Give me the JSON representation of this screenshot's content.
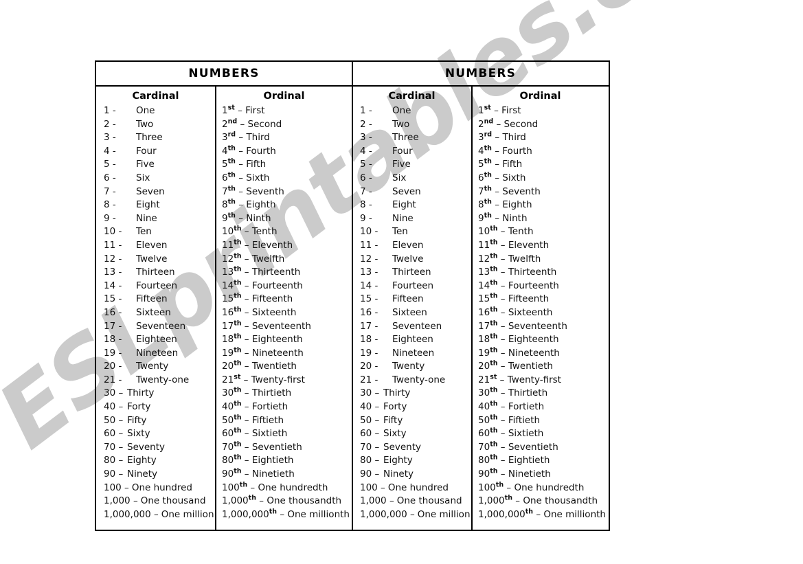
{
  "watermark": {
    "text": "ESLprintables.com"
  },
  "tables": [
    {
      "id": "left",
      "title": "NUMBERS",
      "columns": {
        "cardinal": "Cardinal",
        "ordinal": "Ordinal"
      },
      "cardinal_rows": [
        {
          "num": "1 -",
          "word": "One",
          "spaced": true
        },
        {
          "num": "2 -",
          "word": "Two",
          "spaced": true
        },
        {
          "num": "3 -",
          "word": "Three",
          "spaced": true
        },
        {
          "num": "4 -",
          "word": "Four",
          "spaced": true
        },
        {
          "num": "5 -",
          "word": "Five",
          "spaced": true
        },
        {
          "num": "6 -",
          "word": "Six",
          "spaced": true
        },
        {
          "num": "7 -",
          "word": "Seven",
          "spaced": true
        },
        {
          "num": "8 -",
          "word": "Eight",
          "spaced": true
        },
        {
          "num": "9 -",
          "word": "Nine",
          "spaced": true
        },
        {
          "num": "10 -",
          "word": "Ten",
          "spaced": true
        },
        {
          "num": "11 -",
          "word": "Eleven",
          "spaced": true
        },
        {
          "num": "12 -",
          "word": "Twelve",
          "spaced": true
        },
        {
          "num": "13 -",
          "word": "Thirteen",
          "spaced": true
        },
        {
          "num": "14 -",
          "word": "Fourteen",
          "spaced": true
        },
        {
          "num": "15 -",
          "word": "Fifteen",
          "spaced": true
        },
        {
          "num": "16 -",
          "word": "Sixteen",
          "spaced": true
        },
        {
          "num": "17 -",
          "word": "Seventeen",
          "spaced": true
        },
        {
          "num": "18 -",
          "word": "Eighteen",
          "spaced": true
        },
        {
          "num": "19 -",
          "word": "Nineteen",
          "spaced": true
        },
        {
          "num": "20 -",
          "word": "Twenty",
          "spaced": true
        },
        {
          "num": "21 -",
          "word": "Twenty-one",
          "spaced": true
        },
        {
          "num": "30 –",
          "word": "Thirty",
          "spaced": false
        },
        {
          "num": "40 –",
          "word": "Forty",
          "spaced": false
        },
        {
          "num": "50 –",
          "word": "Fifty",
          "spaced": false
        },
        {
          "num": "60 –",
          "word": "Sixty",
          "spaced": false
        },
        {
          "num": "70 –",
          "word": "Seventy",
          "spaced": false
        },
        {
          "num": "80 –",
          "word": "Eighty",
          "spaced": false
        },
        {
          "num": "90 –",
          "word": "Ninety",
          "spaced": false
        },
        {
          "num": "100 –",
          "word": "One hundred",
          "spaced": false
        },
        {
          "num": "1,000 –",
          "word": "One thousand",
          "spaced": false
        },
        {
          "num": "1,000,000 –",
          "word": "One million",
          "spaced": false
        }
      ],
      "ordinal_rows": [
        {
          "num": "1",
          "sup": "st",
          "word": "First"
        },
        {
          "num": "2",
          "sup": "nd",
          "word": "Second"
        },
        {
          "num": "3",
          "sup": "rd",
          "word": "Third"
        },
        {
          "num": "4",
          "sup": "th",
          "word": "Fourth"
        },
        {
          "num": "5",
          "sup": "th",
          "word": "Fifth"
        },
        {
          "num": "6",
          "sup": "th",
          "word": "Sixth"
        },
        {
          "num": "7",
          "sup": "th",
          "word": "Seventh"
        },
        {
          "num": "8",
          "sup": "th",
          "word": "Eighth"
        },
        {
          "num": "9",
          "sup": "th",
          "word": "Ninth"
        },
        {
          "num": "10",
          "sup": "th",
          "word": "Tenth"
        },
        {
          "num": "11",
          "sup": "th",
          "word": "Eleventh"
        },
        {
          "num": "12",
          "sup": "th",
          "word": "Twelfth"
        },
        {
          "num": "13",
          "sup": "th",
          "word": "Thirteenth"
        },
        {
          "num": "14",
          "sup": "th",
          "word": "Fourteenth"
        },
        {
          "num": "15",
          "sup": "th",
          "word": "Fifteenth"
        },
        {
          "num": "16",
          "sup": "th",
          "word": "Sixteenth"
        },
        {
          "num": "17",
          "sup": "th",
          "word": "Seventeenth"
        },
        {
          "num": "18",
          "sup": "th",
          "word": "Eighteenth"
        },
        {
          "num": "19",
          "sup": "th",
          "word": "Nineteenth"
        },
        {
          "num": "20",
          "sup": "th",
          "word": "Twentieth"
        },
        {
          "num": "21",
          "sup": "st",
          "word": "Twenty-first"
        },
        {
          "num": "30",
          "sup": "th",
          "word": "Thirtieth"
        },
        {
          "num": "40",
          "sup": "th",
          "word": "Fortieth"
        },
        {
          "num": "50",
          "sup": "th",
          "word": "Fiftieth"
        },
        {
          "num": "60",
          "sup": "th",
          "word": "Sixtieth"
        },
        {
          "num": "70",
          "sup": "th",
          "word": "Seventieth"
        },
        {
          "num": "80",
          "sup": "th",
          "word": "Eightieth"
        },
        {
          "num": "90",
          "sup": "th",
          "word": "Ninetieth"
        },
        {
          "num": "100",
          "sup": "th",
          "word": "One hundredth"
        },
        {
          "num": "1,000",
          "sup": "th",
          "word": "One thousandth"
        },
        {
          "num": "1,000,000",
          "sup": "th",
          "word": "One millionth"
        }
      ]
    },
    {
      "id": "right",
      "title": "NUMBERS",
      "columns": {
        "cardinal": "Cardinal",
        "ordinal": "Ordinal"
      },
      "cardinal_rows": [
        {
          "num": "1 -",
          "word": "One",
          "spaced": true
        },
        {
          "num": "2 -",
          "word": "Two",
          "spaced": true
        },
        {
          "num": "3 -",
          "word": "Three",
          "spaced": true
        },
        {
          "num": "4 -",
          "word": "Four",
          "spaced": true
        },
        {
          "num": "5 -",
          "word": "Five",
          "spaced": true
        },
        {
          "num": "6 -",
          "word": "Six",
          "spaced": true
        },
        {
          "num": "7 -",
          "word": "Seven",
          "spaced": true
        },
        {
          "num": "8 -",
          "word": "Eight",
          "spaced": true
        },
        {
          "num": "9 -",
          "word": "Nine",
          "spaced": true
        },
        {
          "num": "10 -",
          "word": "Ten",
          "spaced": true
        },
        {
          "num": "11 -",
          "word": "Eleven",
          "spaced": true
        },
        {
          "num": "12 -",
          "word": "Twelve",
          "spaced": true
        },
        {
          "num": "13 -",
          "word": "Thirteen",
          "spaced": true
        },
        {
          "num": "14 -",
          "word": "Fourteen",
          "spaced": true
        },
        {
          "num": "15 -",
          "word": "Fifteen",
          "spaced": true
        },
        {
          "num": "16 -",
          "word": "Sixteen",
          "spaced": true
        },
        {
          "num": "17 -",
          "word": "Seventeen",
          "spaced": true
        },
        {
          "num": "18 -",
          "word": "Eighteen",
          "spaced": true
        },
        {
          "num": "19 -",
          "word": "Nineteen",
          "spaced": true
        },
        {
          "num": "20 -",
          "word": "Twenty",
          "spaced": true
        },
        {
          "num": "21 -",
          "word": "Twenty-one",
          "spaced": true
        },
        {
          "num": "30 –",
          "word": "Thirty",
          "spaced": false
        },
        {
          "num": "40 –",
          "word": "Forty",
          "spaced": false
        },
        {
          "num": "50 –",
          "word": "Fifty",
          "spaced": false
        },
        {
          "num": "60 –",
          "word": "Sixty",
          "spaced": false
        },
        {
          "num": "70 –",
          "word": "Seventy",
          "spaced": false
        },
        {
          "num": "80 –",
          "word": "Eighty",
          "spaced": false
        },
        {
          "num": "90 –",
          "word": "Ninety",
          "spaced": false
        },
        {
          "num": "100 –",
          "word": "One hundred",
          "spaced": false
        },
        {
          "num": "1,000 –",
          "word": "One thousand",
          "spaced": false
        },
        {
          "num": "1,000,000 –",
          "word": "One million",
          "spaced": false
        }
      ],
      "ordinal_rows": [
        {
          "num": "1",
          "sup": "st",
          "word": "First"
        },
        {
          "num": "2",
          "sup": "nd",
          "word": "Second"
        },
        {
          "num": "3",
          "sup": "rd",
          "word": "Third"
        },
        {
          "num": "4",
          "sup": "th",
          "word": "Fourth"
        },
        {
          "num": "5",
          "sup": "th",
          "word": "Fifth"
        },
        {
          "num": "6",
          "sup": "th",
          "word": "Sixth"
        },
        {
          "num": "7",
          "sup": "th",
          "word": "Seventh"
        },
        {
          "num": "8",
          "sup": "th",
          "word": "Eighth"
        },
        {
          "num": "9",
          "sup": "th",
          "word": "Ninth"
        },
        {
          "num": "10",
          "sup": "th",
          "word": "Tenth"
        },
        {
          "num": "11",
          "sup": "th",
          "word": "Eleventh"
        },
        {
          "num": "12",
          "sup": "th",
          "word": "Twelfth"
        },
        {
          "num": "13",
          "sup": "th",
          "word": "Thirteenth"
        },
        {
          "num": "14",
          "sup": "th",
          "word": "Fourteenth"
        },
        {
          "num": "15",
          "sup": "th",
          "word": "Fifteenth"
        },
        {
          "num": "16",
          "sup": "th",
          "word": "Sixteenth"
        },
        {
          "num": "17",
          "sup": "th",
          "word": "Seventeenth"
        },
        {
          "num": "18",
          "sup": "th",
          "word": "Eighteenth"
        },
        {
          "num": "19",
          "sup": "th",
          "word": "Nineteenth"
        },
        {
          "num": "20",
          "sup": "th",
          "word": "Twentieth"
        },
        {
          "num": "21",
          "sup": "st",
          "word": "Twenty-first"
        },
        {
          "num": "30",
          "sup": "th",
          "word": "Thirtieth"
        },
        {
          "num": "40",
          "sup": "th",
          "word": "Fortieth"
        },
        {
          "num": "50",
          "sup": "th",
          "word": "Fiftieth"
        },
        {
          "num": "60",
          "sup": "th",
          "word": "Sixtieth"
        },
        {
          "num": "70",
          "sup": "th",
          "word": "Seventieth"
        },
        {
          "num": "80",
          "sup": "th",
          "word": "Eightieth"
        },
        {
          "num": "90",
          "sup": "th",
          "word": "Ninetieth"
        },
        {
          "num": "100",
          "sup": "th",
          "word": "One hundredth"
        },
        {
          "num": "1,000",
          "sup": "th",
          "word": "One thousandth"
        },
        {
          "num": "1,000,000",
          "sup": "th",
          "word": "One millionth"
        }
      ]
    }
  ]
}
